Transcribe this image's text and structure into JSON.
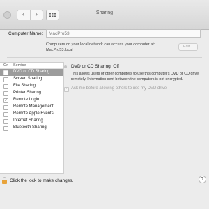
{
  "window": {
    "title": "Sharing"
  },
  "toolbar": {
    "back_glyph": "‹",
    "forward_glyph": "›",
    "grid_icon": "grid-icon"
  },
  "computer_name": {
    "label": "Computer Name:",
    "value": "MacPro53",
    "description_line1": "Computers on your local network can access your computer at:",
    "description_line2": "MacPro53.local",
    "edit_label": "Edit..."
  },
  "services": {
    "header_on": "On",
    "header_service": "Service",
    "items": [
      {
        "name": "DVD or CD Sharing",
        "checked": false,
        "selected": true
      },
      {
        "name": "Screen Sharing",
        "checked": false,
        "selected": false
      },
      {
        "name": "File Sharing",
        "checked": false,
        "selected": false
      },
      {
        "name": "Printer Sharing",
        "checked": false,
        "selected": false
      },
      {
        "name": "Remote Login",
        "checked": true,
        "selected": false
      },
      {
        "name": "Remote Management",
        "checked": false,
        "selected": false
      },
      {
        "name": "Remote Apple Events",
        "checked": false,
        "selected": false
      },
      {
        "name": "Internet Sharing",
        "checked": false,
        "selected": false
      },
      {
        "name": "Bluetooth Sharing",
        "checked": false,
        "selected": false
      }
    ]
  },
  "detail": {
    "status": "DVD or CD Sharing: Off",
    "description": "This allows users of other computers to use this computer's DVD or CD drive remotely. Information sent between the computers is not encrypted.",
    "ask_label": "Ask me before allowing others to use my DVD drive",
    "ask_checked": true
  },
  "footer": {
    "lock_text": "Click the lock to make changes.",
    "help_label": "?"
  },
  "colors": {
    "selected_row": "#9c9c9c",
    "window_bg": "#ececec",
    "lock": "#e8a33a"
  }
}
